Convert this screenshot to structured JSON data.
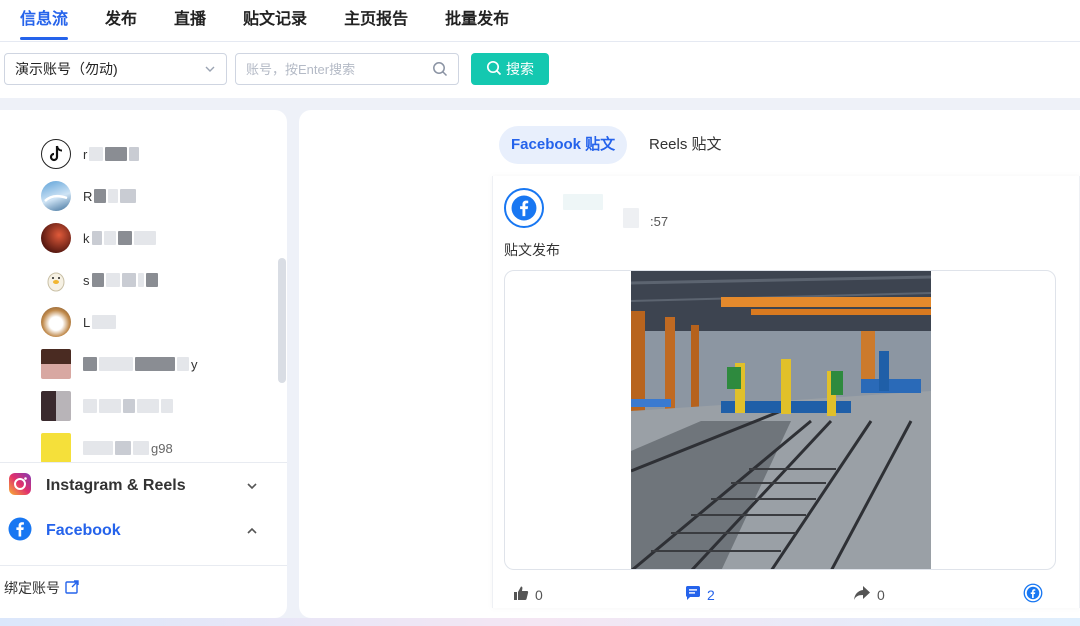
{
  "nav": {
    "tabs": [
      {
        "label": "信息流",
        "active": true
      },
      {
        "label": "发布"
      },
      {
        "label": "直播"
      },
      {
        "label": "贴文记录"
      },
      {
        "label": "主页报告"
      },
      {
        "label": "批量发布"
      }
    ]
  },
  "filter": {
    "account_select_value": "演示账号（勿动)",
    "search_placeholder": "账号，按Enter搜索",
    "search_button": "搜索"
  },
  "sidebar": {
    "accounts": [
      {
        "initial": "r",
        "avatar": "tiktok-logo"
      },
      {
        "initial": "R",
        "avatar": "sky-photo"
      },
      {
        "initial": "k",
        "avatar": "red-photo"
      },
      {
        "initial": "s",
        "avatar": "cartoon-duck"
      },
      {
        "initial": "L",
        "avatar": "cat-photo"
      },
      {
        "initial": "",
        "suffix": "y",
        "avatar": "pixel-thumb"
      },
      {
        "initial": "",
        "avatar": "pixel-thumb"
      },
      {
        "initial": "",
        "suffix": "g98",
        "avatar": "yellow-thumb"
      }
    ],
    "platforms": [
      {
        "label": "Instagram & Reels",
        "expanded": false
      },
      {
        "label": "Facebook",
        "expanded": true
      }
    ],
    "bind_account": "绑定账号"
  },
  "content": {
    "tabs": [
      {
        "label": "Facebook 贴文",
        "active": true
      },
      {
        "label": "Reels 贴文"
      }
    ],
    "post": {
      "time_suffix": ":57",
      "text": "贴文发布",
      "likes": "0",
      "comments": "2",
      "shares": "0"
    }
  },
  "colors": {
    "accent": "#2563eb",
    "search_button": "#14c8b0",
    "facebook": "#1877f2"
  }
}
